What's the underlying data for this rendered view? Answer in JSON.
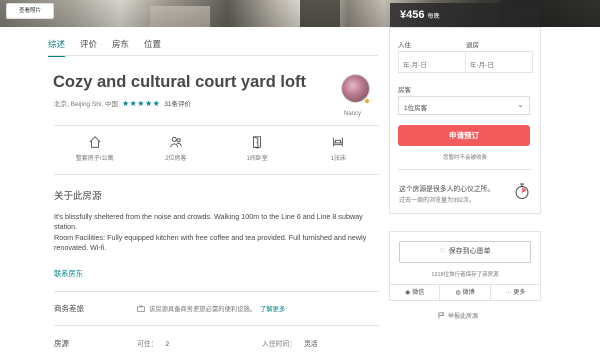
{
  "hero": {
    "photo_button": "查看照片"
  },
  "price": {
    "amount": "¥456",
    "unit": "每晚"
  },
  "tabs": [
    {
      "label": "综述"
    },
    {
      "label": "评价"
    },
    {
      "label": "房东"
    },
    {
      "label": "位置"
    }
  ],
  "listing": {
    "title": "Cozy and cultural court yard loft",
    "location": "北京, Beijing Shi, 中国",
    "stars": "★★★★★",
    "review_count": "31条评价",
    "host_name": "Nancy"
  },
  "features": [
    {
      "icon": "house-icon",
      "label": "整套房子/公寓"
    },
    {
      "icon": "guests-icon",
      "label": "2位房客"
    },
    {
      "icon": "door-icon",
      "label": "1间卧室"
    },
    {
      "icon": "bed-icon",
      "label": "1张床"
    }
  ],
  "about": {
    "heading": "关于此房源",
    "line1": "It's blissfully sheltered from the noise and crowds. Walking 100m to the Line 6 and Line 8 subway station.",
    "line2": "Room Facilities: Fully equipped kitchen with free coffee and tea provided. Full furnished and newly renovated. Wi-fi.",
    "contact": "联系房东"
  },
  "business": {
    "label": "商务差旅",
    "note": "该房源具备商务差旅必需的便利设施。",
    "more": "了解更多"
  },
  "room": {
    "label": "房源",
    "occupancy_label": "可住：",
    "occupancy_value": "2",
    "checkin_label": "入住时间：",
    "checkin_value": "灵活"
  },
  "booking": {
    "checkin_label": "入住",
    "checkout_label": "退房",
    "date_placeholder": "年-月-日",
    "guests_label": "房客",
    "guests_value": "1位房客",
    "book_button": "申请预订",
    "no_charge": "您暂时不会被收费",
    "popular_line1": "这个房源是很多人的心仪之所。",
    "popular_line2": "过去一周的浏览量为392次。"
  },
  "wishlist": {
    "save_button": "保存到心愿单",
    "saved_count": "1319位旅行者保存了该房源",
    "share": [
      {
        "label": "微信"
      },
      {
        "label": "微博"
      },
      {
        "label": "更多"
      }
    ]
  },
  "report": "举报此房源",
  "colors": {
    "accent": "#008489",
    "book_button": "#f25b5b",
    "star": "#008489"
  }
}
